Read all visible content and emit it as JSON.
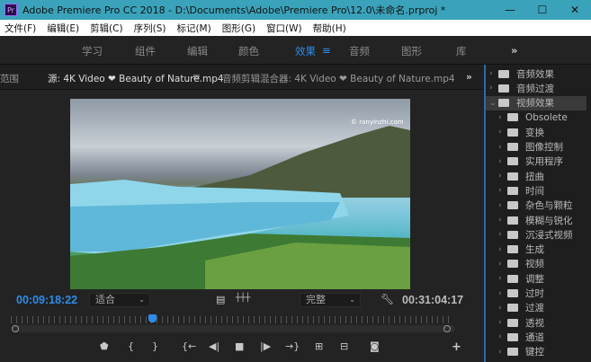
{
  "window": {
    "title": "Adobe Premiere Pro CC 2018 - D:\\Documents\\Adobe\\Premiere Pro\\12.0\\未命名.prproj *",
    "logo": "Pr"
  },
  "menu": [
    "文件(F)",
    "编辑(E)",
    "剪辑(C)",
    "序列(S)",
    "标记(M)",
    "图形(G)",
    "窗口(W)",
    "帮助(H)"
  ],
  "workspaces": {
    "items": [
      "学习",
      "组件",
      "编辑",
      "颜色",
      "效果",
      "音频",
      "图形",
      "库"
    ],
    "active": "效果",
    "more": "»"
  },
  "panel_tabs": {
    "left": "范围",
    "source": "源: 4K Video ❤ Beauty of Nature.mp4",
    "audio_mixer": "音频剪辑混合器: 4K Video ❤ Beauty of Nature.mp4",
    "more": "»"
  },
  "video": {
    "watermark": "© ranyinzhi.com"
  },
  "monitor": {
    "current_time": "00:09:18:22",
    "duration": "00:31:04:17",
    "zoom_select": "适合",
    "quality_select": "完整",
    "playhead_fraction": 0.31
  },
  "effects": {
    "items": [
      {
        "label": "音频效果",
        "level": 0,
        "expanded": false
      },
      {
        "label": "音频过渡",
        "level": 0,
        "expanded": false
      },
      {
        "label": "视频效果",
        "level": 0,
        "expanded": true
      },
      {
        "label": "Obsolete",
        "level": 1
      },
      {
        "label": "变换",
        "level": 1
      },
      {
        "label": "图像控制",
        "level": 1
      },
      {
        "label": "实用程序",
        "level": 1
      },
      {
        "label": "扭曲",
        "level": 1
      },
      {
        "label": "时间",
        "level": 1
      },
      {
        "label": "杂色与颗粒",
        "level": 1
      },
      {
        "label": "模糊与锐化",
        "level": 1
      },
      {
        "label": "沉浸式视频",
        "level": 1
      },
      {
        "label": "生成",
        "level": 1
      },
      {
        "label": "视频",
        "level": 1
      },
      {
        "label": "调整",
        "level": 1
      },
      {
        "label": "过时",
        "level": 1
      },
      {
        "label": "过渡",
        "level": 1
      },
      {
        "label": "透视",
        "level": 1
      },
      {
        "label": "通道",
        "level": 1
      },
      {
        "label": "键控",
        "level": 1
      }
    ]
  },
  "colors": {
    "accent": "#2d8ceb",
    "titlebar": "#3aa3bb"
  }
}
